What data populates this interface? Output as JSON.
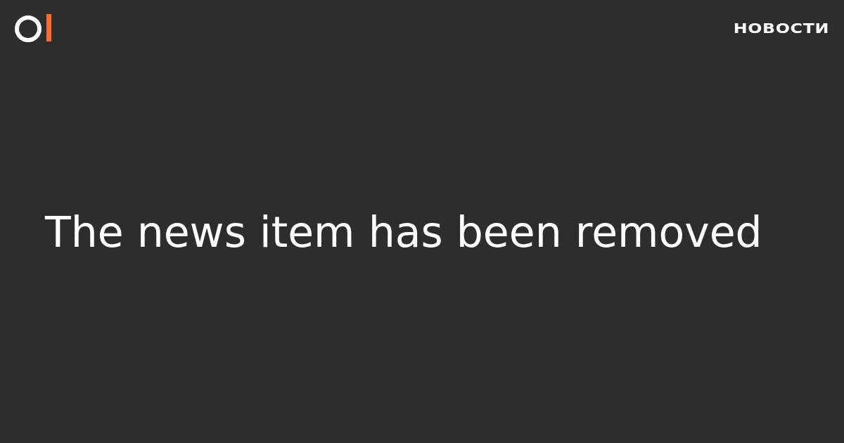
{
  "header": {
    "section_label": "НОВОСТИ"
  },
  "message": "The news item has been removed"
}
